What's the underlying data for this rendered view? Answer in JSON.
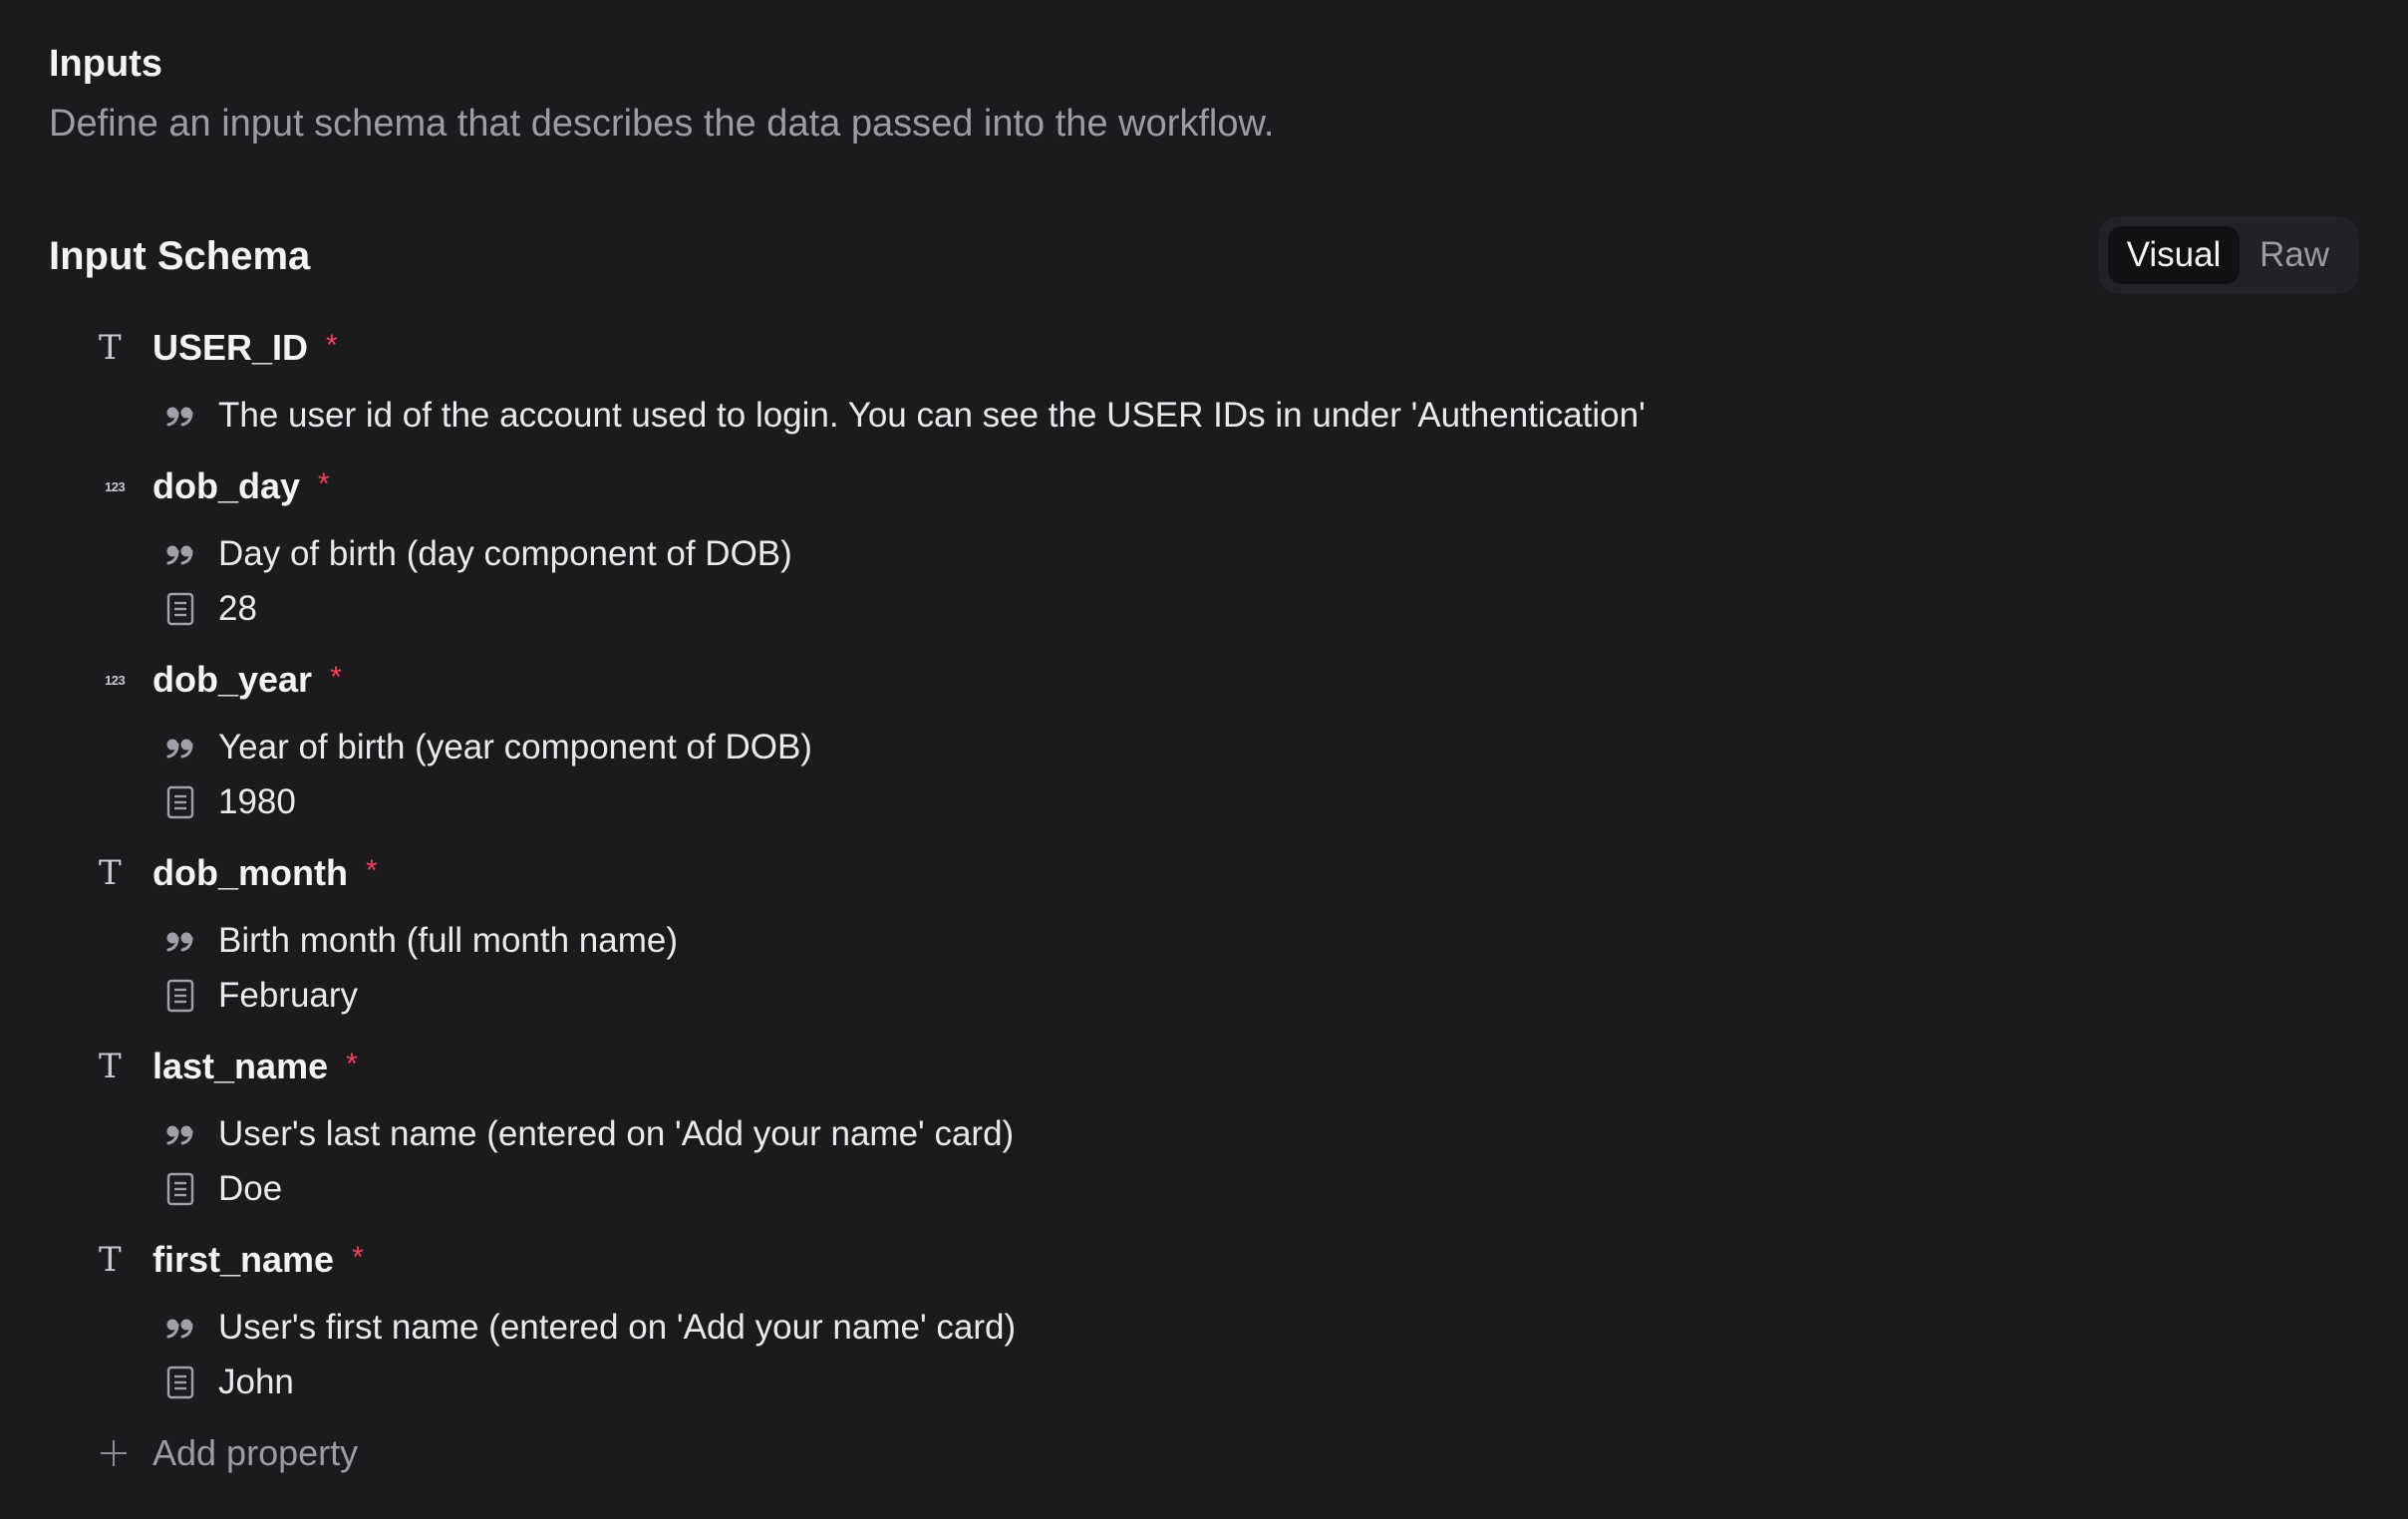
{
  "header": {
    "title": "Inputs",
    "subtitle": "Define an input schema that describes the data passed into the workflow."
  },
  "schema": {
    "title": "Input Schema",
    "toggle": {
      "visual_label": "Visual",
      "raw_label": "Raw",
      "selected": "Visual"
    },
    "required_marker": "*",
    "properties": [
      {
        "name": "USER_ID",
        "type_icon": "text-type-icon",
        "type_glyph": "T",
        "required": true,
        "description": "The user id of the account used to login. You can see the USER IDs in under 'Authentication'",
        "example": null
      },
      {
        "name": "dob_day",
        "type_icon": "number-type-icon",
        "type_glyph": "123",
        "required": true,
        "description": "Day of birth (day component of DOB)",
        "example": "28"
      },
      {
        "name": "dob_year",
        "type_icon": "number-type-icon",
        "type_glyph": "123",
        "required": true,
        "description": "Year of birth (year component of DOB)",
        "example": "1980"
      },
      {
        "name": "dob_month",
        "type_icon": "text-type-icon",
        "type_glyph": "T",
        "required": true,
        "description": "Birth month (full month name)",
        "example": "February"
      },
      {
        "name": "last_name",
        "type_icon": "text-type-icon",
        "type_glyph": "T",
        "required": true,
        "description": "User's last name (entered on 'Add your name' card)",
        "example": "Doe"
      },
      {
        "name": "first_name",
        "type_icon": "text-type-icon",
        "type_glyph": "T",
        "required": true,
        "description": "User's first name (entered on 'Add your name' card)",
        "example": "John"
      }
    ],
    "add_label": "Add property"
  },
  "icons": {
    "description": "quote-icon",
    "example": "document-icon",
    "add": "plus-icon"
  },
  "colors": {
    "background": "#1b1b1e",
    "required": "#ff3b5c",
    "muted_text": "#9c9ca4",
    "toggle_active_bg": "#111113",
    "toggle_bg": "#222226"
  }
}
